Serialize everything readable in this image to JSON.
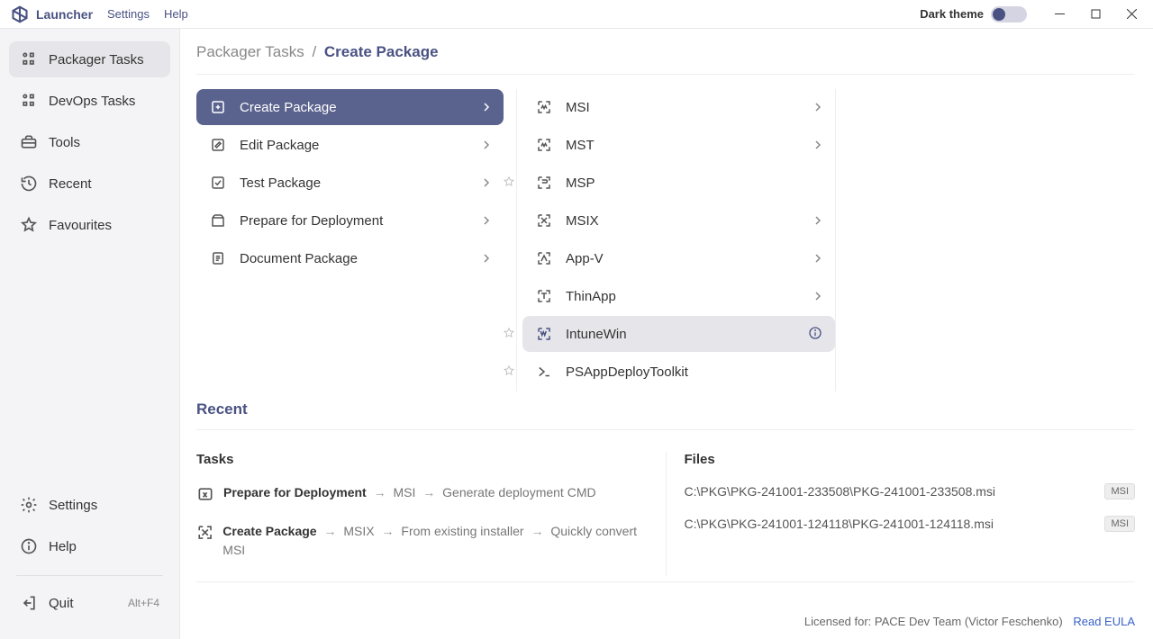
{
  "title": {
    "app_name": "Launcher",
    "menu": [
      "Settings",
      "Help"
    ],
    "dark_theme_label": "Dark theme"
  },
  "sidebar": {
    "items": [
      {
        "label": "Packager Tasks",
        "active": true,
        "icon": "packager"
      },
      {
        "label": "DevOps Tasks",
        "icon": "devops"
      },
      {
        "label": "Tools",
        "icon": "tools"
      },
      {
        "label": "Recent",
        "icon": "recent"
      },
      {
        "label": "Favourites",
        "icon": "star"
      }
    ],
    "bottom": [
      {
        "label": "Settings",
        "icon": "gear"
      },
      {
        "label": "Help",
        "icon": "info"
      }
    ],
    "quit": {
      "label": "Quit",
      "shortcut": "Alt+F4"
    }
  },
  "breadcrumb": {
    "root": "Packager Tasks",
    "current": "Create Package"
  },
  "left_tasks": [
    {
      "label": "Create Package",
      "selected": true,
      "chevron": true
    },
    {
      "label": "Edit Package",
      "chevron": true
    },
    {
      "label": "Test Package",
      "chevron": true
    },
    {
      "label": "Prepare for Deployment",
      "chevron": true
    },
    {
      "label": "Document Package",
      "chevron": true
    }
  ],
  "right_tasks": [
    {
      "label": "MSI",
      "chevron": true
    },
    {
      "label": "MST",
      "chevron": true
    },
    {
      "label": "MSP",
      "star_left": true
    },
    {
      "label": "MSIX",
      "chevron": true
    },
    {
      "label": "App-V",
      "chevron": true
    },
    {
      "label": "ThinApp",
      "chevron": true
    },
    {
      "label": "IntuneWin",
      "hover": true,
      "star_left": true,
      "info": true
    },
    {
      "label": "PSAppDeployToolkit",
      "star_left": true
    }
  ],
  "recent": {
    "title": "Recent",
    "tasks_header": "Tasks",
    "files_header": "Files",
    "tasks": [
      {
        "main": "Prepare for Deployment",
        "steps": [
          "MSI",
          "Generate deployment CMD"
        ]
      },
      {
        "main": "Create Package",
        "steps": [
          "MSIX",
          "From existing installer",
          "Quickly convert MSI"
        ]
      }
    ],
    "files": [
      {
        "path": "C:\\PKG\\PKG-241001-233508\\PKG-241001-233508.msi",
        "tag": "MSI"
      },
      {
        "path": "C:\\PKG\\PKG-241001-124118\\PKG-241001-124118.msi",
        "tag": "MSI"
      }
    ]
  },
  "footer": {
    "license": "Licensed for: PACE Dev Team (Victor Feschenko)",
    "eula": "Read EULA"
  }
}
